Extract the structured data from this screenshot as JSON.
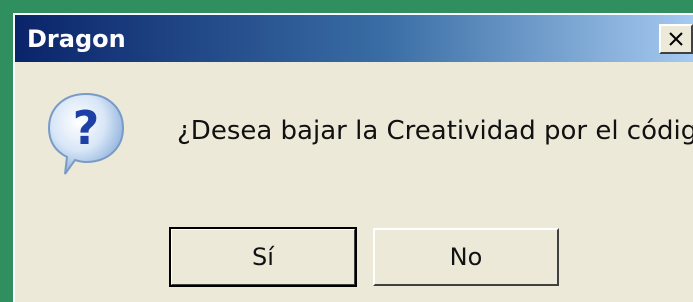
{
  "window": {
    "title": "Dragon"
  },
  "dialog": {
    "message": "¿Desea bajar la Creatividad por el código?",
    "icon": "question-icon",
    "buttons": {
      "yes_label": "Sí",
      "no_label": "No"
    }
  },
  "colors": {
    "titlebar_start": "#0a246a",
    "titlebar_end": "#a6caf0",
    "dialog_bg": "#ece9d8",
    "desktop_bg": "#2f8f5e"
  }
}
